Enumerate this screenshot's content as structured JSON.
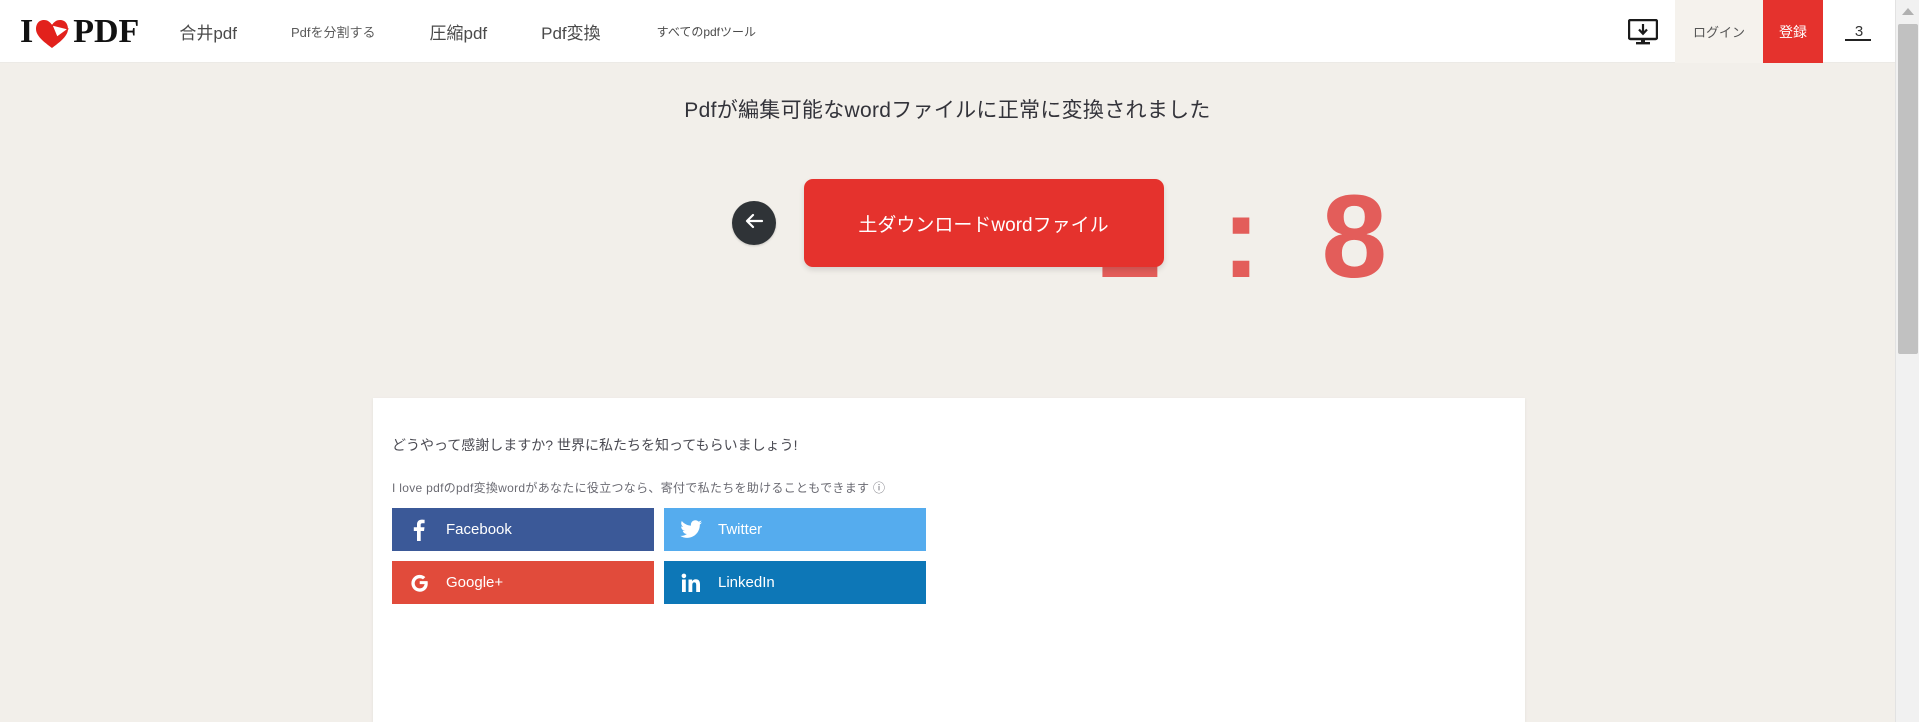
{
  "header": {
    "logo": {
      "left": "I",
      "right": "PDF",
      "heart_icon": "heart-icon"
    },
    "nav": [
      {
        "label": "合井pdf",
        "name": "nav-merge-pdf",
        "size": "normal"
      },
      {
        "label": "Pdfを分割する",
        "name": "nav-split-pdf",
        "size": "small"
      },
      {
        "label": "圧縮pdf",
        "name": "nav-compress-pdf",
        "size": "normal"
      },
      {
        "label": "Pdf変換",
        "name": "nav-convert-pdf",
        "size": "normal"
      },
      {
        "label": "すべてのpdfツール",
        "name": "nav-all-pdf-tools",
        "size": "tiny"
      }
    ],
    "desktop_icon": "desktop-download-icon",
    "login_label": "ログイン",
    "register_label": "登録",
    "language_value": "3"
  },
  "hero": {
    "title": "Pdfが編集可能なwordファイルに正常に変換されました",
    "back_icon": "arrow-left-icon",
    "download_label": "土ダウンロードwordファイル",
    "countdown": "1 : 8"
  },
  "card": {
    "title": "どうやって感謝しますか? 世界に私たちを知ってもらいましょう!",
    "subtitle": "I love pdfのpdf変換wordがあなたに役立つなら、寄付で私たちを助けることもできます ⓘ",
    "social": [
      {
        "label": "Facebook",
        "class": "fb",
        "icon": "facebook-icon",
        "name": "share-facebook-button"
      },
      {
        "label": "Twitter",
        "class": "tw",
        "icon": "twitter-icon",
        "name": "share-twitter-button"
      },
      {
        "label": "Google+",
        "class": "gp",
        "icon": "google-plus-icon",
        "name": "share-google-plus-button"
      },
      {
        "label": "LinkedIn",
        "class": "li",
        "icon": "linkedin-icon",
        "name": "share-linkedin-button"
      }
    ]
  },
  "colors": {
    "brand_red": "#e5322d",
    "page_bg": "#f2efea",
    "facebook": "#3b5998",
    "twitter": "#55acee",
    "google_plus": "#e14b3b",
    "linkedin": "#0d77b7"
  }
}
